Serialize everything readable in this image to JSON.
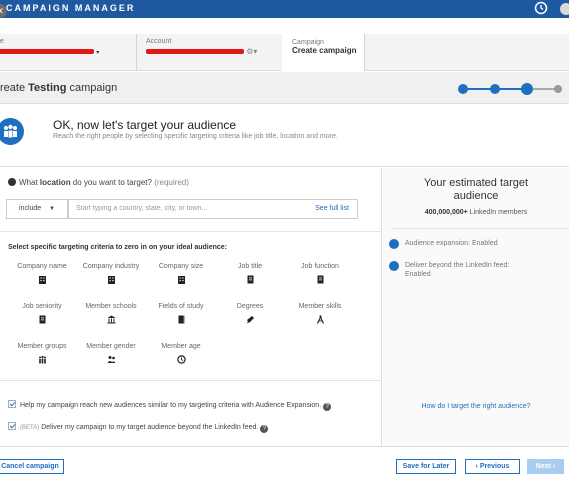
{
  "topbar": {
    "title": "CAMPAIGN MANAGER"
  },
  "crumbs": {
    "account_label": "Account",
    "campaign_label": "Campaign",
    "campaign_value": "Create campaign"
  },
  "header": {
    "title_prefix": "reate ",
    "title_bold": "Testing",
    "title_suffix": " campaign",
    "steps_total": 4,
    "current_step": 3
  },
  "intro": {
    "heading": "OK, now let's target your audience",
    "subtext": "Reach the right people by selecting specific targeting criteria like job title, location and more."
  },
  "location": {
    "q_prefix": "What ",
    "q_bold": "location",
    "q_suffix": " do you want to target?",
    "required": "(required)",
    "include_value": "include",
    "placeholder": "Start typing a country, state, city, or town...",
    "full_list": "See full list"
  },
  "criteria": {
    "title": "Select specific targeting criteria to zero in on your ideal audience:",
    "items": [
      {
        "label": "Company name",
        "icon": "building-icon"
      },
      {
        "label": "Company industry",
        "icon": "building-icon"
      },
      {
        "label": "Company size",
        "icon": "building-icon"
      },
      {
        "label": "Job title",
        "icon": "document-icon"
      },
      {
        "label": "Job function",
        "icon": "document-icon"
      },
      {
        "label": "Job seniority",
        "icon": "document-icon"
      },
      {
        "label": "Member schools",
        "icon": "school-icon"
      },
      {
        "label": "Fields of study",
        "icon": "book-icon"
      },
      {
        "label": "Degrees",
        "icon": "graduation-cap-icon"
      },
      {
        "label": "Member skills",
        "icon": "compass-icon"
      },
      {
        "label": "Member groups",
        "icon": "group-icon"
      },
      {
        "label": "Member gender",
        "icon": "people-icon"
      },
      {
        "label": "Member age",
        "icon": "clock-icon"
      }
    ]
  },
  "options": {
    "expansion": "Help my campaign reach new audiences similar to my targeting criteria with Audience Expansion.",
    "beta_tag": "(BETA)",
    "offsite": "Deliver my campaign to my target audience beyond the LinkedIn feed."
  },
  "estimate": {
    "title": "Your estimated target audience",
    "count": "400,000,000+",
    "count_suffix": " LinkedIn members",
    "expansion": "Audience expansion: Enabled",
    "deliver": "Deliver beyond the LinkedIn feed: Enabled",
    "help_link": "How do I target the right audience?"
  },
  "footer": {
    "cancel": "Cancel campaign",
    "save": "Save for Later",
    "previous": "‹ Previous",
    "next": "Next ›"
  },
  "colors": {
    "brand": "#1f5aa0",
    "accent": "#1f6fc0",
    "disabled": "#a9cdee"
  }
}
